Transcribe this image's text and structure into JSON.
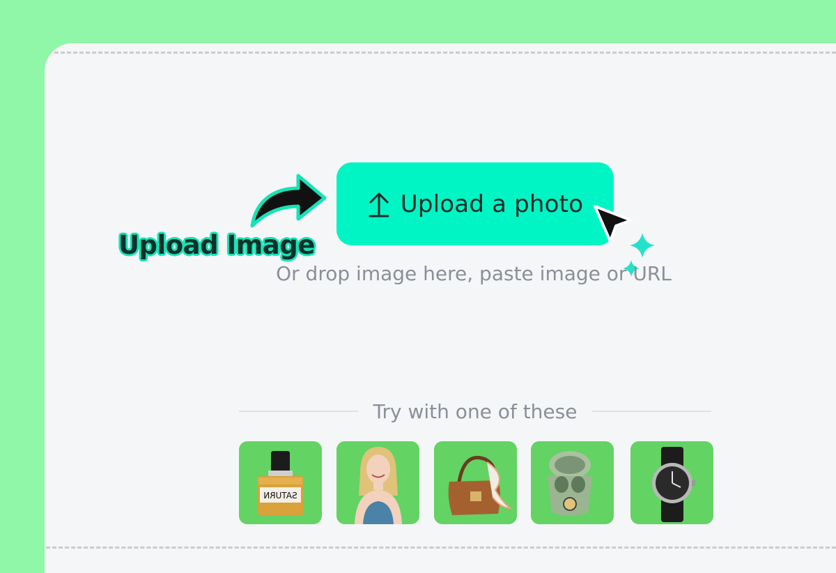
{
  "upload": {
    "button_label": "Upload a photo",
    "drop_hint": "Or drop image here, paste image or URL"
  },
  "annotation": {
    "label": "Upload Image"
  },
  "samples": {
    "heading": "Try with one of these",
    "items": [
      {
        "kind": "perfume-bottle",
        "label_text": "SATURN"
      },
      {
        "kind": "woman-portrait"
      },
      {
        "kind": "handbag"
      },
      {
        "kind": "earbuds-case"
      },
      {
        "kind": "wristwatch"
      }
    ]
  },
  "colors": {
    "page_background": "#8ff7a7",
    "panel_background": "#f5f6f8",
    "accent": "#00f5c4",
    "sample_background": "#63d363",
    "muted_text": "#8a8f98"
  },
  "icons": {
    "upload": "upload-arrow-icon",
    "pointer": "mouse-cursor-icon",
    "sparkle": "sparkle-icon",
    "annotation_arrow": "curved-arrow-icon"
  }
}
